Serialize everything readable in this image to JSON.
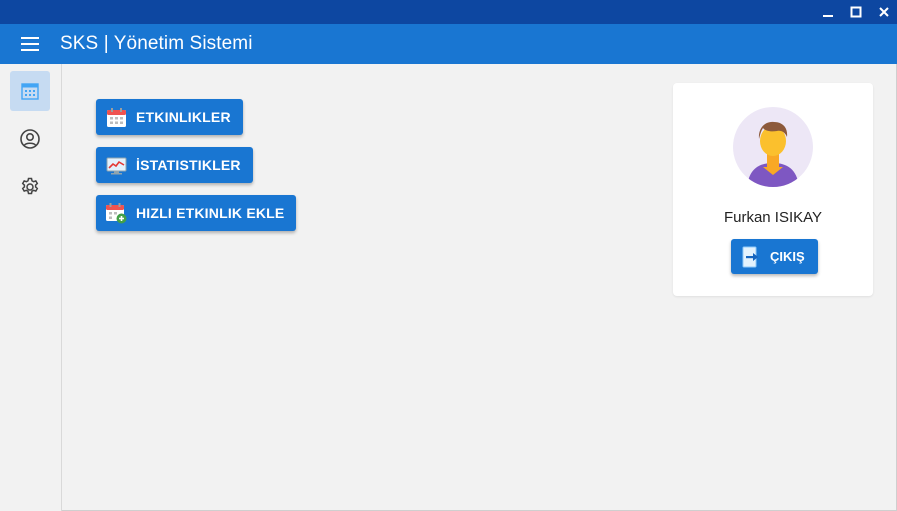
{
  "window": {
    "controls": [
      "minimize",
      "maximize",
      "close"
    ]
  },
  "appbar": {
    "title": "SKS | Yönetim Sistemi",
    "menu_icon": "hamburger-menu-icon"
  },
  "sidebar": {
    "items": [
      {
        "name": "calendar",
        "icon": "calendar-icon",
        "active": true
      },
      {
        "name": "profile",
        "icon": "user-circle-icon",
        "active": false
      },
      {
        "name": "settings",
        "icon": "gear-icon",
        "active": false
      }
    ]
  },
  "main": {
    "buttons": [
      {
        "label": "ETKINLIKLER",
        "icon": "calendar-icon"
      },
      {
        "label": "İSTATISTIKLER",
        "icon": "chart-monitor-icon"
      },
      {
        "label": "HIZLI ETKINLIK EKLE",
        "icon": "calendar-add-icon"
      }
    ]
  },
  "profile": {
    "name": "Furkan ISIKAY",
    "logout_label": "ÇIKIŞ",
    "logout_icon": "logout-icon"
  },
  "colors": {
    "titlebar": "#0d47a1",
    "appbar": "#1976d2",
    "button": "#1976d2",
    "sidebar_active": "#c6dbf2",
    "background": "#f2f2f2"
  }
}
